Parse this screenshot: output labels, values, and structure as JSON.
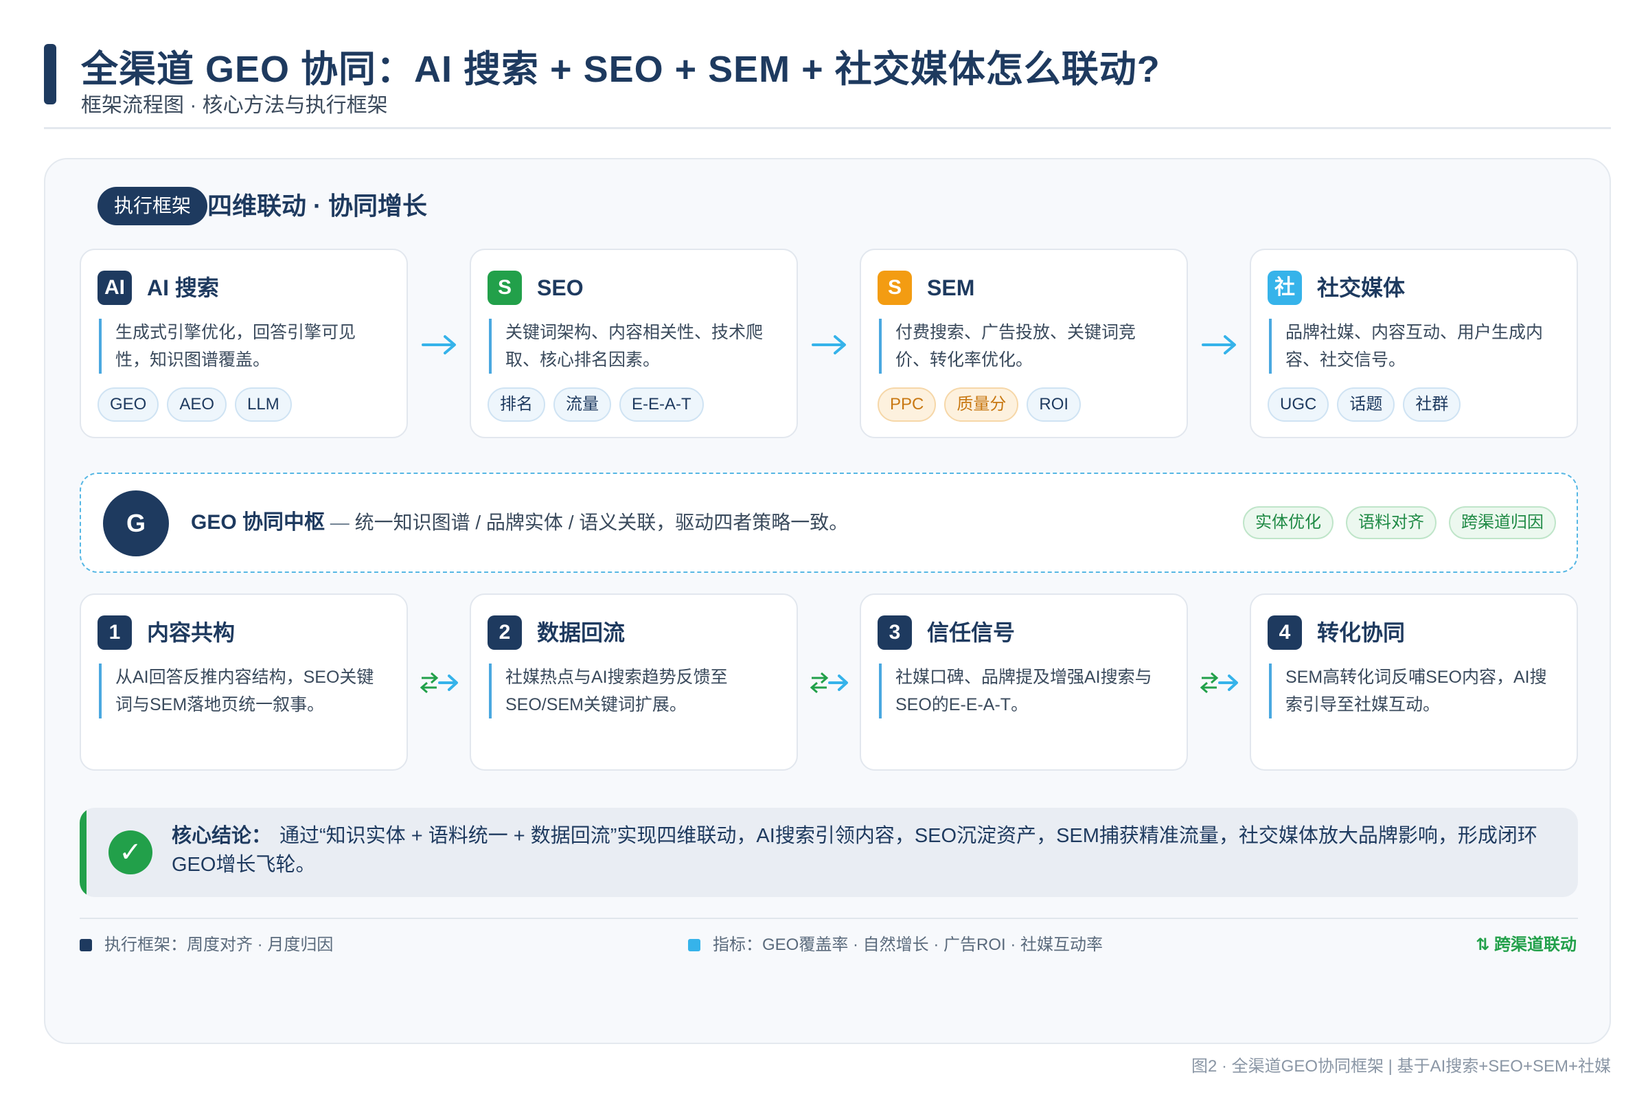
{
  "header": {
    "title": "全渠道 GEO 协同：AI 搜索 + SEO + SEM + 社交媒体怎么联动?",
    "subtitle": "框架流程图 · 核心方法与执行框架"
  },
  "section": {
    "pill": "执行框架",
    "title": "四维联动 · 协同增长"
  },
  "channels": [
    {
      "badge": "AI",
      "title": "AI 搜索",
      "desc": "生成式引擎优化，回答引擎可见性，知识图谱覆盖。",
      "tags": [
        "GEO",
        "AEO",
        "LLM"
      ]
    },
    {
      "badge": "S",
      "title": "SEO",
      "desc": "关键词架构、内容相关性、技术爬取、核心排名因素。",
      "tags": [
        "排名",
        "流量",
        "E-E-A-T"
      ]
    },
    {
      "badge": "S",
      "title": "SEM",
      "desc": "付费搜索、广告投放、关键词竞价、转化率优化。",
      "tags": [
        "PPC",
        "质量分",
        "ROI"
      ]
    },
    {
      "badge": "社",
      "title": "社交媒体",
      "desc": "品牌社媒、内容互动、用户生成内容、社交信号。",
      "tags": [
        "UGC",
        "话题",
        "社群"
      ]
    }
  ],
  "hub": {
    "badge": "G",
    "title": "GEO 协同中枢",
    "dash": " — ",
    "text": "统一知识图谱 / 品牌实体 / 语义关联，驱动四者策略一致。",
    "tags": [
      "实体优化",
      "语料对齐",
      "跨渠道归因"
    ]
  },
  "steps": [
    {
      "num": "1",
      "title": "内容共构",
      "desc": "从AI回答反推内容结构，SEO关键词与SEM落地页统一叙事。"
    },
    {
      "num": "2",
      "title": "数据回流",
      "desc": "社媒热点与AI搜索趋势反馈至SEO/SEM关键词扩展。"
    },
    {
      "num": "3",
      "title": "信任信号",
      "desc": "社媒口碑、品牌提及增强AI搜索与SEO的E-E-A-T。"
    },
    {
      "num": "4",
      "title": "转化协同",
      "desc": "SEM高转化词反哺SEO内容，AI搜索引导至社媒互动。"
    }
  ],
  "conclusion": {
    "label": "核心结论：",
    "text": "通过“知识实体 + 语料统一 + 数据回流”实现四维联动，AI搜索引领内容，SEO沉淀资产，SEM捕获精准流量，社交媒体放大品牌影响，形成闭环GEO增长飞轮。"
  },
  "footer": {
    "left": "执行框架：周度对齐 · 月度归因",
    "middle": "指标：GEO覆盖率 · 自然增长 · 广告ROI · 社媒互动率",
    "right": "跨渠道联动",
    "right_icon": "⇅"
  },
  "caption": "图2 · 全渠道GEO协同框架 | 基于AI搜索+SEO+SEM+社媒",
  "colors": {
    "navy": "#1e3a5f",
    "green": "#22a04a",
    "orange": "#f39c12",
    "sky": "#36b3ea"
  }
}
